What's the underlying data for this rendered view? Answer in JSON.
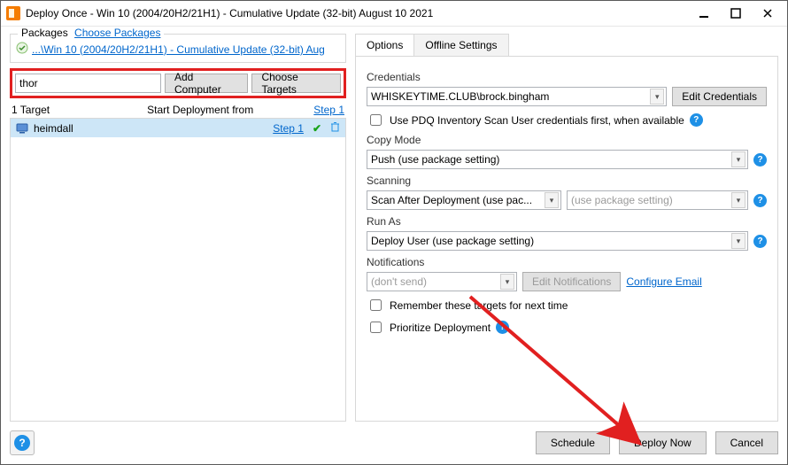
{
  "titlebar": {
    "title": "Deploy Once - Win 10 (2004/20H2/21H1) - Cumulative Update (32-bit) August 10 2021"
  },
  "packages": {
    "legend": "Packages",
    "choose_link": "Choose Packages",
    "package_link": "...\\Win 10 (2004/20H2/21H1) - Cumulative Update (32-bit) Aug"
  },
  "target_input": {
    "value": "thor",
    "add_btn": "Add Computer",
    "choose_btn": "Choose Targets"
  },
  "targets_header": {
    "count": "1 Target",
    "start_from": "Start Deployment from",
    "step": "Step 1"
  },
  "targets": [
    {
      "name": "heimdall",
      "step": "Step 1"
    }
  ],
  "tabs": {
    "options": "Options",
    "offline": "Offline Settings"
  },
  "options": {
    "credentials_label": "Credentials",
    "credentials_value": "WHISKEYTIME.CLUB\\brock.bingham",
    "edit_credentials": "Edit Credentials",
    "use_pdq_label": "Use PDQ Inventory Scan User credentials first, when available",
    "copy_mode_label": "Copy Mode",
    "copy_mode_value": "Push (use package setting)",
    "scanning_label": "Scanning",
    "scanning_value": "Scan After Deployment (use pac...",
    "scanning_secondary_placeholder": "(use package setting)",
    "runas_label": "Run As",
    "runas_value": "Deploy User (use package setting)",
    "notifications_label": "Notifications",
    "notifications_value": "(don't send)",
    "edit_notifications": "Edit Notifications",
    "configure_email": "Configure Email",
    "remember_label": "Remember these targets for next time",
    "prioritize_label": "Prioritize Deployment"
  },
  "buttons": {
    "schedule": "Schedule",
    "deploy": "Deploy Now",
    "cancel": "Cancel"
  }
}
